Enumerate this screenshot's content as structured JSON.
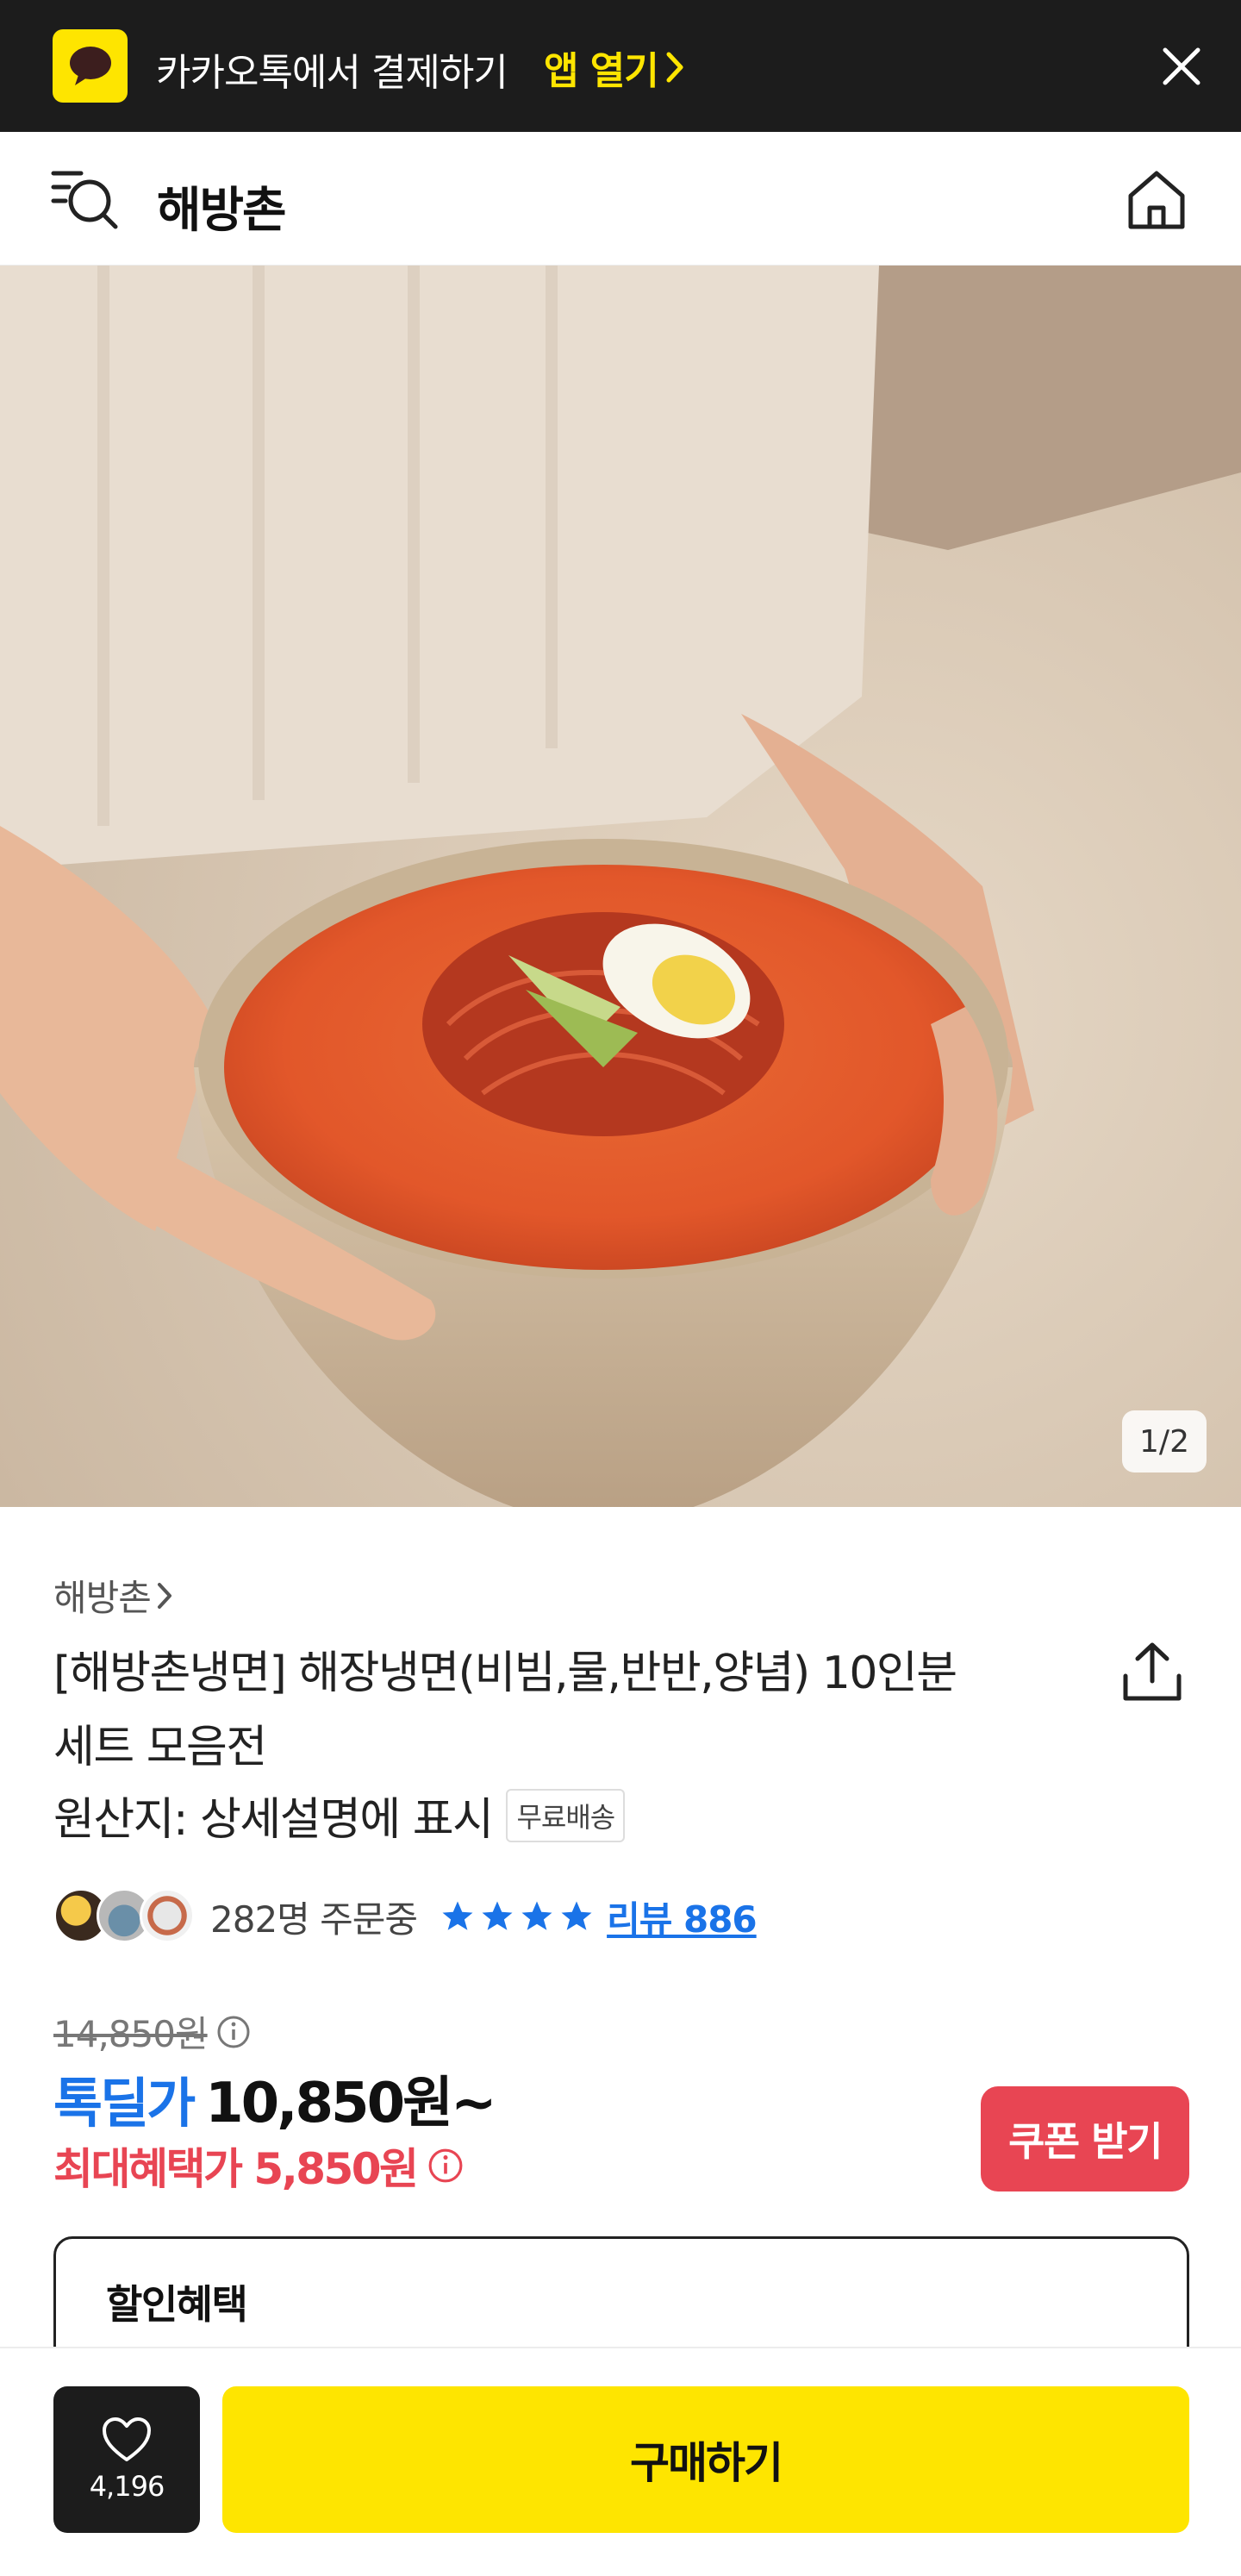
{
  "banner": {
    "text": "카카오톡에서 결제하기",
    "open_label": "앱 열기"
  },
  "header": {
    "title": "해방촌"
  },
  "hero": {
    "page_indicator": "1/2"
  },
  "product": {
    "brand": "해방촌",
    "title_line1": "[해방촌냉면] 해장냉면(비빔,물,반반,양념) 10인분",
    "title_line2": "세트 모음전",
    "origin": "원산지: 상세설명에 표시",
    "shipping_badge": "무료배송",
    "order_count": "282명 주문중",
    "rating_stars": 4,
    "review_label": "리뷰 886"
  },
  "price": {
    "original": "14,850원",
    "deal_label": "톡딜가",
    "deal_price": "10,850원~",
    "max_benefit": "최대혜택가 5,850원",
    "coupon_button": "쿠폰 받기"
  },
  "discount": {
    "title": "할인혜택"
  },
  "bottom": {
    "wish_count": "4,196",
    "buy_label": "구매하기"
  },
  "colors": {
    "kakao_yellow": "#FEE500",
    "deal_blue": "#1a73e8",
    "benefit_red": "#e84553",
    "dark": "#1c1c1c"
  },
  "icons": {
    "banner_logo": "kakaotalk-icon",
    "banner_close": "close-icon",
    "header_menu": "menu-search-icon",
    "header_home": "home-icon",
    "share": "share-icon",
    "wish": "heart-icon",
    "info": "info-icon",
    "star": "star-icon"
  }
}
